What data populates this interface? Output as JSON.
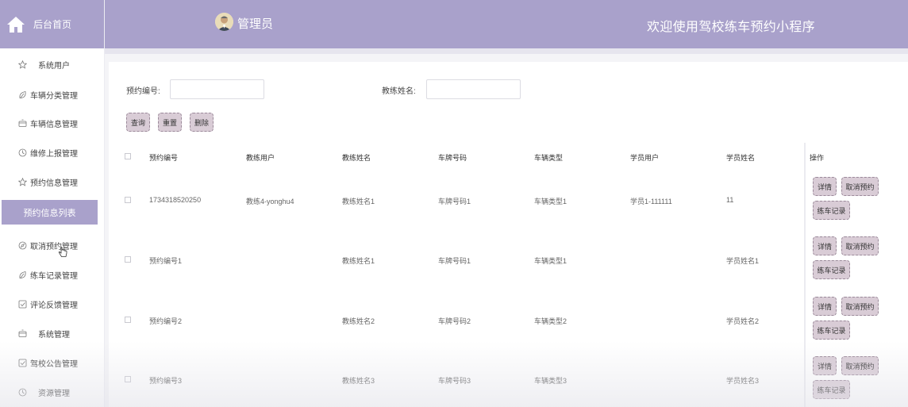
{
  "sidebar": {
    "brand": "后台首页",
    "items": [
      {
        "label": "系统用户",
        "icon": "star-icon"
      },
      {
        "label": "车辆分类管理",
        "icon": "leaf-icon"
      },
      {
        "label": "车辆信息管理",
        "icon": "box-icon"
      },
      {
        "label": "维修上报管理",
        "icon": "clock-icon"
      },
      {
        "label": "预约信息管理",
        "icon": "star-icon"
      },
      {
        "label": "预约信息列表",
        "active": true
      },
      {
        "label": "取消预约管理",
        "icon": "compass-icon"
      },
      {
        "label": "练车记录管理",
        "icon": "leaf-icon"
      },
      {
        "label": "评论反馈管理",
        "icon": "check-square-icon"
      },
      {
        "label": "系统管理",
        "icon": "box-icon"
      },
      {
        "label": "驾校公告管理",
        "icon": "check-square-icon"
      },
      {
        "label": "资源管理",
        "icon": "clock-icon"
      }
    ]
  },
  "header": {
    "admin_name": "管理员",
    "welcome": "欢迎使用驾校练车预约小程序",
    "colors": {
      "accent": "#a9a1cb",
      "button": "#d9ccd6"
    }
  },
  "search": {
    "booking_no_label": "预约编号:",
    "coach_name_label": "教练姓名:",
    "query": "查询",
    "reset": "重置",
    "delete": "删除"
  },
  "table": {
    "columns": [
      "预约编号",
      "教练用户",
      "教练姓名",
      "车牌号码",
      "车辆类型",
      "学员用户",
      "学员姓名",
      "操作"
    ],
    "rows": [
      [
        "1734318520250",
        "教练4-yonghu4",
        "教练姓名1",
        "车牌号码1",
        "车辆类型1",
        "学员1-111111",
        "11"
      ],
      [
        "预约编号1",
        "",
        "教练姓名1",
        "车牌号码1",
        "车辆类型1",
        "",
        "学员姓名1"
      ],
      [
        "预约编号2",
        "",
        "教练姓名2",
        "车牌号码2",
        "车辆类型2",
        "",
        "学员姓名2"
      ],
      [
        "预约编号3",
        "",
        "教练姓名3",
        "车牌号码3",
        "车辆类型3",
        "",
        "学员姓名3"
      ]
    ],
    "actions": {
      "detail": "详情",
      "cancel": "取消预约",
      "record": "练车记录"
    }
  }
}
